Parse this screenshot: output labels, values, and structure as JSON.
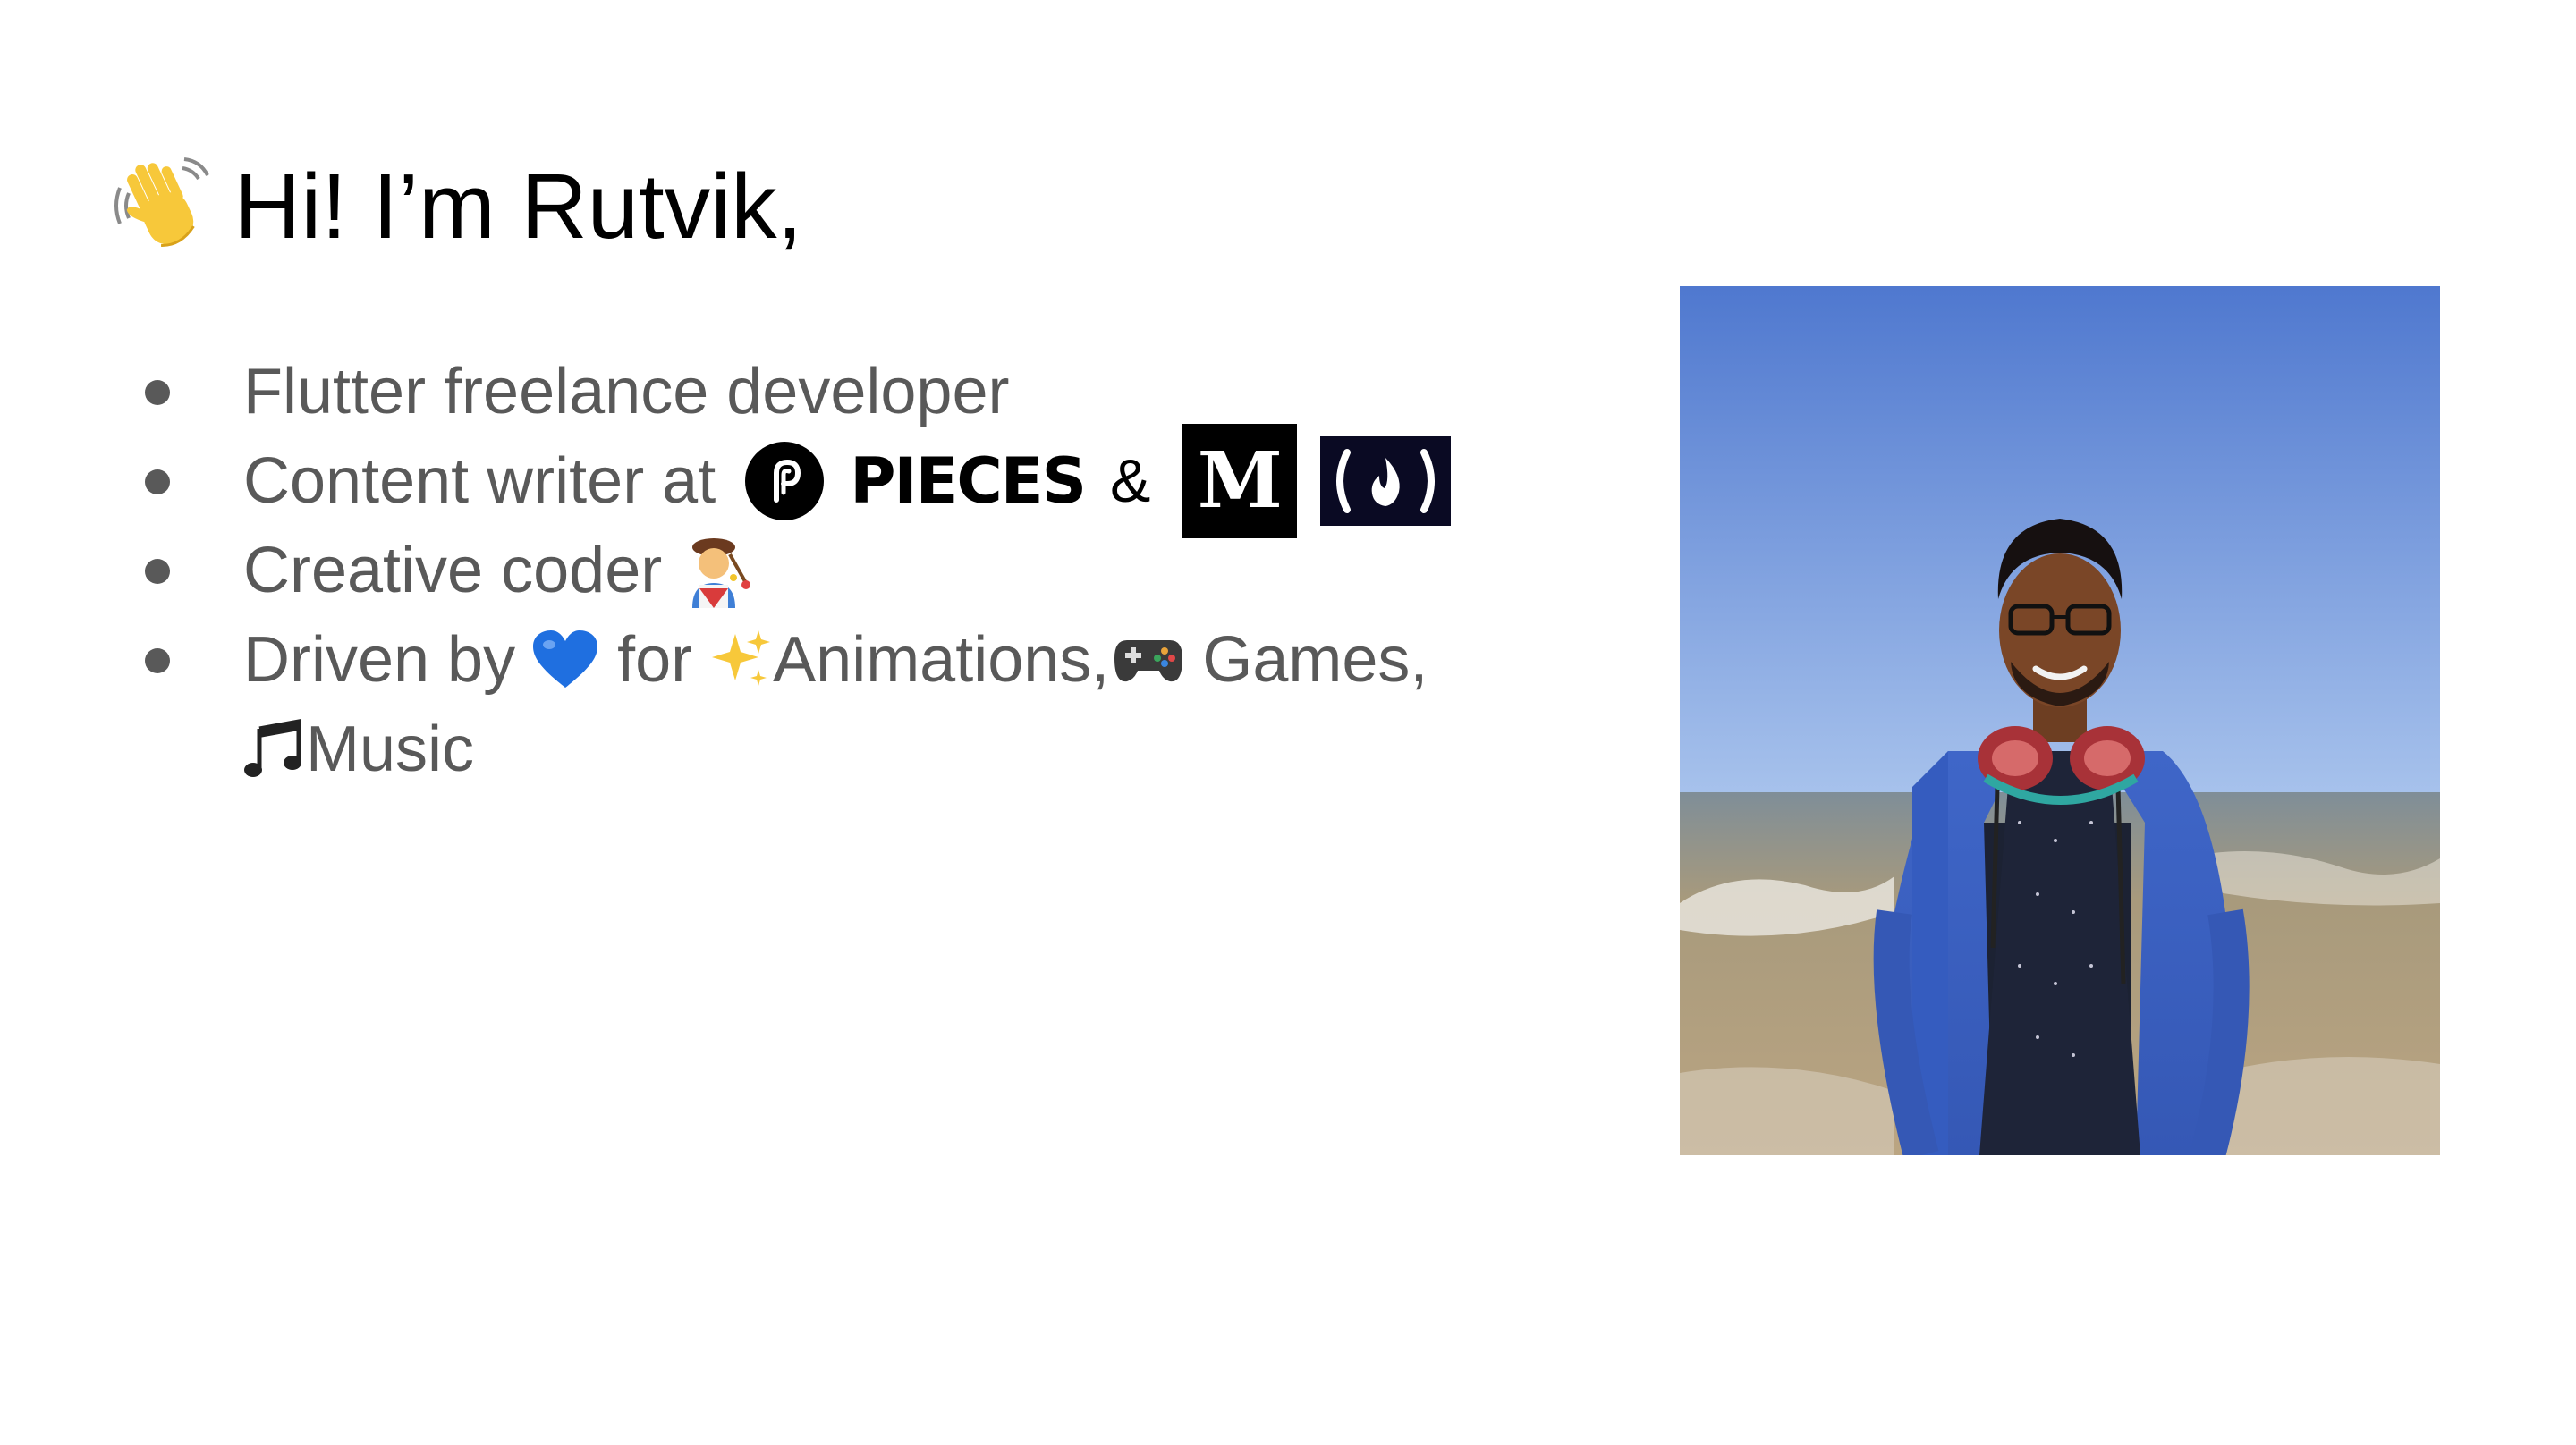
{
  "slide": {
    "title": "Hi! I’m Rutvik,",
    "title_icon": "waving-hand-emoji",
    "bullets": [
      {
        "text": "Flutter freelance developer"
      },
      {
        "text": "Content writer at",
        "logos": [
          {
            "name": "pieces-logo",
            "label": "PIECES"
          },
          {
            "name": "ampersand",
            "label": "&"
          },
          {
            "name": "medium-logo",
            "label": "M"
          },
          {
            "name": "freecodecamp-logo",
            "label": "(🔥)"
          }
        ]
      },
      {
        "text": "Creative coder",
        "icon": "artist-emoji"
      },
      {
        "parts": [
          "Driven by",
          "for",
          "Animations,",
          "Games,"
        ],
        "icons": [
          "blue-heart-emoji",
          "sparkles-emoji",
          "game-controller-emoji"
        ],
        "continuation": "Music",
        "continuation_icon": "music-notes-emoji"
      }
    ],
    "photo": {
      "subject": "portrait-at-beach-photo"
    },
    "colors": {
      "title": "#000000",
      "body_text": "#595959",
      "background": "#ffffff",
      "fcc_bg": "#0a0a23",
      "sky": "#5a86d8",
      "heart": "#1f6fe0"
    }
  }
}
